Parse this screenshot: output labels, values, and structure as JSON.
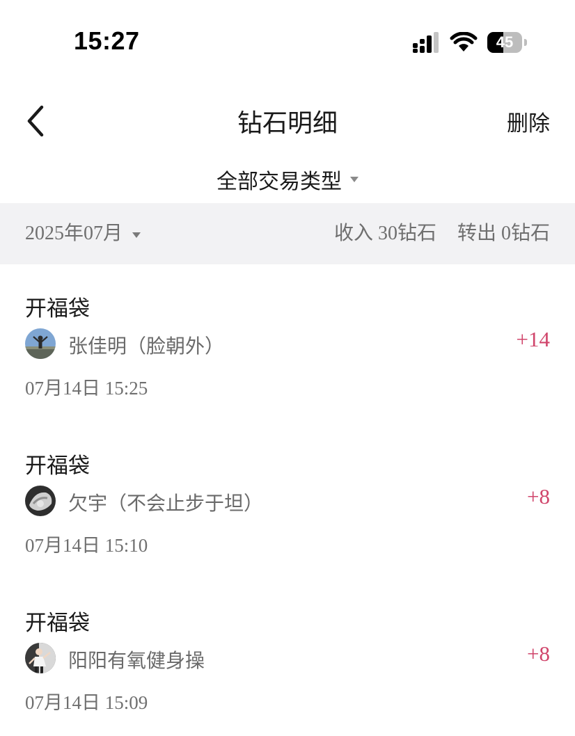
{
  "status_bar": {
    "time": "15:27",
    "battery_level": "45",
    "battery_fraction": 0.45,
    "icons": [
      "signal-icon",
      "wifi-icon",
      "battery-icon"
    ]
  },
  "nav": {
    "title": "钻石明细",
    "delete_label": "删除",
    "back_icon": "back-chevron-icon"
  },
  "filter": {
    "type_label": "全部交易类型"
  },
  "summary": {
    "month": "2025年07月",
    "income": "收入 30钻石",
    "outgoing": "转出 0钻石"
  },
  "colors": {
    "amount_positive": "#d0456b",
    "summary_background": "#f2f2f4"
  },
  "transactions": [
    {
      "title": "开福袋",
      "name": "张佳明（脸朝外）",
      "amount": "+14",
      "time": "07月14日 15:25"
    },
    {
      "title": "开福袋",
      "name": "欠宇（不会止步于坦）",
      "amount": "+8",
      "time": "07月14日 15:10"
    },
    {
      "title": "开福袋",
      "name": "阳阳有氧健身操",
      "amount": "+8",
      "time": "07月14日 15:09"
    }
  ]
}
